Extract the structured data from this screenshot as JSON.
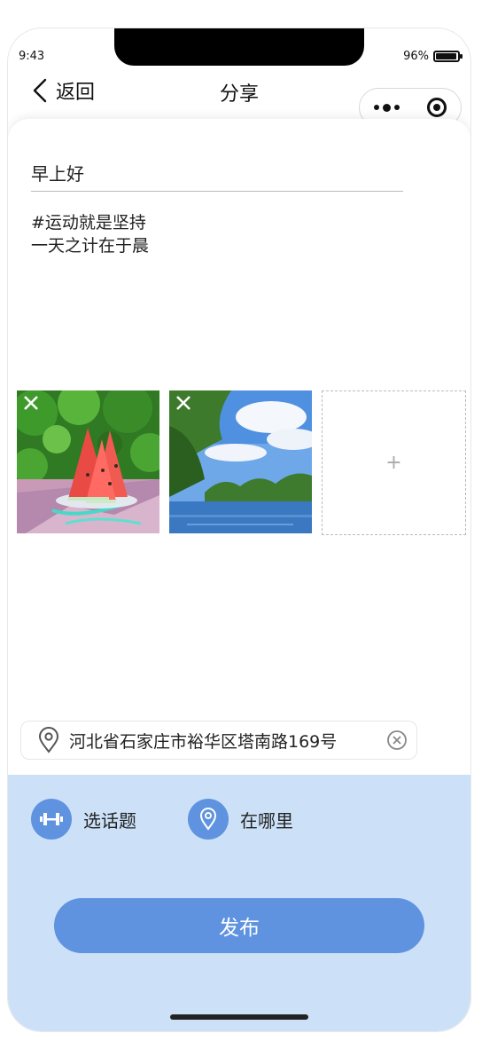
{
  "status_bar": {
    "time": "9:43",
    "battery": "96%",
    "battery_level": 0.96
  },
  "navbar": {
    "back_label": "返回",
    "title": "分享"
  },
  "post": {
    "title_value": "早上好",
    "body_lines": [
      "#运动就是坚持",
      "一天之计在于晨"
    ]
  },
  "photos": [
    {
      "alt": "watermelon",
      "icon": "close-icon"
    },
    {
      "alt": "lake landscape",
      "icon": "close-icon"
    }
  ],
  "add_photo": {
    "label": "+"
  },
  "location": {
    "address": "河北省石家庄市裕华区塔南路169号",
    "icon": "map-pin-icon"
  },
  "actions": {
    "topic_label": "选话题",
    "where_label": "在哪里"
  },
  "publish": {
    "label": "发布"
  },
  "colors": {
    "accent": "#5f93e0",
    "panel_bg": "#cce1f8"
  }
}
